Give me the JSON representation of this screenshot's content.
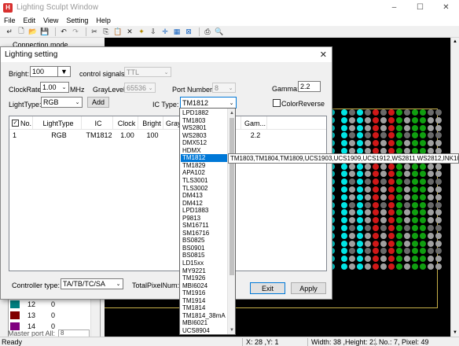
{
  "window": {
    "title": "Lighting Sculpt Window",
    "icon_letter": "H",
    "controls": [
      "–",
      "☐",
      "✕"
    ]
  },
  "menu": [
    "File",
    "Edit",
    "View",
    "Setting",
    "Help"
  ],
  "toolbar_icons": [
    "back-icon",
    "new-icon",
    "open-icon",
    "save-icon",
    "undo-icon",
    "redo-icon",
    "cut-icon",
    "copy-icon",
    "paste-icon",
    "delete-icon",
    "wand-icon",
    "download-icon",
    "crosshair-icon",
    "grid-icon",
    "box-icon",
    "print-icon",
    "zoom-icon"
  ],
  "left_panel": {
    "connection_mode": "Connection mode",
    "ports": [
      {
        "num": "12",
        "val": "0",
        "color": "#008080"
      },
      {
        "num": "13",
        "val": "0",
        "color": "#800000"
      },
      {
        "num": "14",
        "val": "0",
        "color": "#800080"
      }
    ],
    "master_port_label": "Master port All:",
    "master_port_value": "8"
  },
  "dialog": {
    "title": "Lighting setting",
    "bright_label": "Bright:",
    "bright_value": "100",
    "control_signals_label": "control signals:",
    "control_signals_value": "TTL",
    "clockrate_label": "ClockRate:",
    "clockrate_value": "1.00",
    "clockrate_unit": "MHz",
    "graylevel_label": "GrayLevel:",
    "graylevel_value": "65536",
    "port_number_label": "Port Number:",
    "port_number_value": "8",
    "gamma_label": "Gamma:",
    "gamma_value": "2.2",
    "lighttype_label": "LightType:",
    "lighttype_value": "RGB",
    "add_label": "Add",
    "ictype_label": "IC Type:",
    "ictype_value": "TM1812",
    "colorreverse_label": "ColorReverse",
    "table_headers": [
      "No.",
      "LightType",
      "IC",
      "Clock",
      "Bright",
      "Gray",
      "Gam..."
    ],
    "table_rows": [
      {
        "no": "1",
        "lighttype": "RGB",
        "ic": "TM1812",
        "clock": "1.00",
        "bright": "100",
        "gamma": "2.2"
      }
    ],
    "controller_type_label": "Controller type:",
    "controller_type_value": "TA/TB/TC/SA",
    "total_pixel_label": "TotalPixelNum:",
    "exit_label": "Exit",
    "apply_label": "Apply"
  },
  "ic_list": {
    "items": [
      "LPD1882",
      "TM1803",
      "WS2801",
      "WS2803",
      "DMX512",
      "HDMX",
      "TM1812",
      "TM1829",
      "APA102",
      "TLS3001",
      "TLS3002",
      "DM413",
      "DM412",
      "LPD1883",
      "P9813",
      "SM16711",
      "SM16716",
      "BS0825",
      "BS0901",
      "BS0815",
      "LD15xx",
      "MY9221",
      "TM1926",
      "MBI6024",
      "TM1916",
      "TM1914",
      "TM1814",
      "TM1814_38mA",
      "MBI6021",
      "UCS8904"
    ],
    "selected": "TM1812"
  },
  "tooltip": "TM1803,TM1804,TM1809,UCS1903,UCS1909,UCS1912,WS2811,WS2812,INK1003",
  "status": {
    "ready": "Ready",
    "coord": "X: 28 ,Y: 1",
    "size": "Width: 38 ,Height: 21",
    "info": "No.: 7, Pixel: 49"
  },
  "colors": {
    "cyan": "#00e5e5",
    "red": "#d01818",
    "green": "#10a010",
    "gray": "#a0a0a0",
    "grid_border": "#c8b14a",
    "selection": "#0078d7"
  }
}
